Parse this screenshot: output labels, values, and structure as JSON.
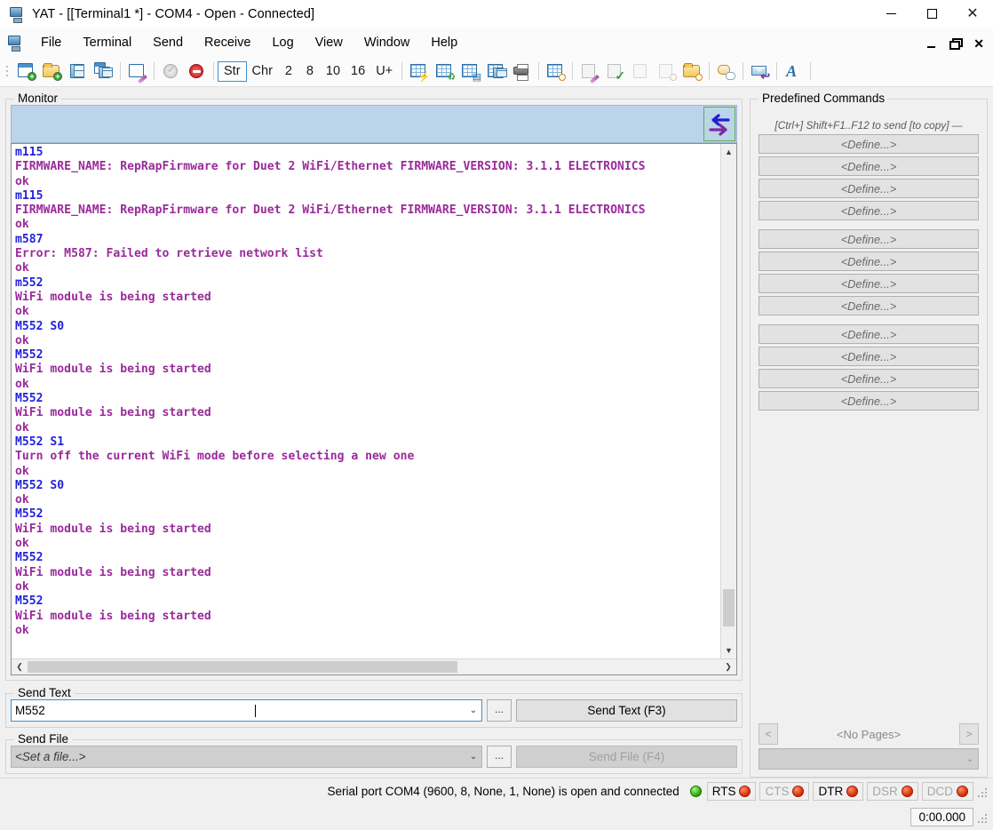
{
  "window": {
    "title": "YAT - [[Terminal1 *] - COM4 - Open - Connected]",
    "icon": "monitor-icon",
    "minimize": "minimize-icon",
    "maximize": "maximize-icon",
    "close": "close-icon"
  },
  "menubar": {
    "items": [
      {
        "label": "File"
      },
      {
        "label": "Terminal"
      },
      {
        "label": "Send"
      },
      {
        "label": "Receive"
      },
      {
        "label": "Log"
      },
      {
        "label": "View"
      },
      {
        "label": "Window"
      },
      {
        "label": "Help"
      }
    ],
    "mdi": {
      "minimize": "mdi-minimize-icon",
      "restore": "mdi-restore-icon",
      "close": "mdi-close-icon"
    }
  },
  "toolbar": {
    "buttons": [
      {
        "name": "new-terminal-icon",
        "kind": "icon"
      },
      {
        "name": "open-terminal-icon",
        "kind": "icon"
      },
      {
        "name": "save-terminal-icon",
        "kind": "icon"
      },
      {
        "name": "save-all-terminals-icon",
        "kind": "icon"
      },
      {
        "name": "terminal-settings-icon",
        "kind": "icon"
      },
      {
        "name": "start-terminal-icon",
        "kind": "icon"
      },
      {
        "name": "stop-terminal-icon",
        "kind": "icon"
      },
      {
        "name": "print-terminal-icon",
        "kind": "icon"
      },
      {
        "name": "find-icon",
        "kind": "icon"
      },
      {
        "name": "edit-icon",
        "kind": "icon"
      },
      {
        "name": "validate-icon",
        "kind": "icon"
      },
      {
        "name": "log-clear-icon",
        "kind": "icon"
      },
      {
        "name": "log-view-icon",
        "kind": "icon"
      },
      {
        "name": "log-open-directory-icon",
        "kind": "icon"
      },
      {
        "name": "autoresponse-icon",
        "kind": "icon"
      },
      {
        "name": "autoaction-icon",
        "kind": "icon"
      },
      {
        "name": "format-font-icon",
        "kind": "icon"
      }
    ],
    "radix": {
      "options": [
        "Str",
        "Chr",
        "2",
        "8",
        "10",
        "16",
        "U+"
      ],
      "selected": "Str"
    }
  },
  "monitor": {
    "title": "Monitor",
    "swap_icon": "bidirectional-swap-icon",
    "lines": [
      {
        "dir": "tx",
        "text": "m115"
      },
      {
        "dir": "rx",
        "text": "FIRMWARE_NAME: RepRapFirmware for Duet 2 WiFi/Ethernet FIRMWARE_VERSION: 3.1.1 ELECTRONICS"
      },
      {
        "dir": "rx",
        "text": "ok"
      },
      {
        "dir": "tx",
        "text": "m115"
      },
      {
        "dir": "rx",
        "text": "FIRMWARE_NAME: RepRapFirmware for Duet 2 WiFi/Ethernet FIRMWARE_VERSION: 3.1.1 ELECTRONICS"
      },
      {
        "dir": "rx",
        "text": "ok"
      },
      {
        "dir": "tx",
        "text": "m587"
      },
      {
        "dir": "rx",
        "text": "Error: M587: Failed to retrieve network list"
      },
      {
        "dir": "rx",
        "text": "ok"
      },
      {
        "dir": "tx",
        "text": "m552"
      },
      {
        "dir": "rx",
        "text": "WiFi module is being started"
      },
      {
        "dir": "rx",
        "text": "ok"
      },
      {
        "dir": "tx",
        "text": "M552 S0"
      },
      {
        "dir": "rx",
        "text": "ok"
      },
      {
        "dir": "tx",
        "text": "M552"
      },
      {
        "dir": "rx",
        "text": "WiFi module is being started"
      },
      {
        "dir": "rx",
        "text": "ok"
      },
      {
        "dir": "tx",
        "text": "M552"
      },
      {
        "dir": "rx",
        "text": "WiFi module is being started"
      },
      {
        "dir": "rx",
        "text": "ok"
      },
      {
        "dir": "tx",
        "text": "M552 S1"
      },
      {
        "dir": "rx",
        "text": "Turn off the current WiFi mode before selecting a new one"
      },
      {
        "dir": "rx",
        "text": "ok"
      },
      {
        "dir": "tx",
        "text": "M552 S0"
      },
      {
        "dir": "rx",
        "text": "ok"
      },
      {
        "dir": "tx",
        "text": "M552"
      },
      {
        "dir": "rx",
        "text": "WiFi module is being started"
      },
      {
        "dir": "rx",
        "text": "ok"
      },
      {
        "dir": "tx",
        "text": "M552"
      },
      {
        "dir": "rx",
        "text": "WiFi module is being started"
      },
      {
        "dir": "rx",
        "text": "ok"
      },
      {
        "dir": "tx",
        "text": "M552"
      },
      {
        "dir": "rx",
        "text": "WiFi module is being started"
      },
      {
        "dir": "rx",
        "text": "ok"
      }
    ]
  },
  "send_text": {
    "title": "Send Text",
    "value": "M552",
    "browse_label": "...",
    "button_label": "Send Text (F3)"
  },
  "send_file": {
    "title": "Send File",
    "value": "<Set a file...>",
    "browse_label": "...",
    "button_label": "Send File (F4)"
  },
  "predefined": {
    "title": "Predefined Commands",
    "hint": "[Ctrl+] Shift+F1..F12 to send [to copy] —",
    "groups": [
      [
        "<Define...>",
        "<Define...>",
        "<Define...>",
        "<Define...>"
      ],
      [
        "<Define...>",
        "<Define...>",
        "<Define...>",
        "<Define...>"
      ],
      [
        "<Define...>",
        "<Define...>",
        "<Define...>",
        "<Define...>"
      ]
    ],
    "pager": {
      "prev": "<",
      "label": "<No Pages>",
      "next": ">"
    },
    "page_combo_value": ""
  },
  "statusbar": {
    "message": "Serial port COM4 (9600, 8, None, 1, None) is open and connected",
    "connection_led": "green",
    "signals": [
      {
        "label": "RTS",
        "led": "red",
        "enabled": true
      },
      {
        "label": "CTS",
        "led": "red",
        "enabled": false
      },
      {
        "label": "DTR",
        "led": "red",
        "enabled": true
      },
      {
        "label": "DSR",
        "led": "red",
        "enabled": false
      },
      {
        "label": "DCD",
        "led": "red",
        "enabled": false
      }
    ]
  },
  "bottombar": {
    "timer": "0:00.000"
  },
  "colors": {
    "tx": "#2222dd",
    "rx": "#9b2a9b",
    "accent": "#3b8fd4",
    "monitor_header": "#bcd4ea",
    "led_green": "#2aa000",
    "led_red": "#d42a00"
  }
}
